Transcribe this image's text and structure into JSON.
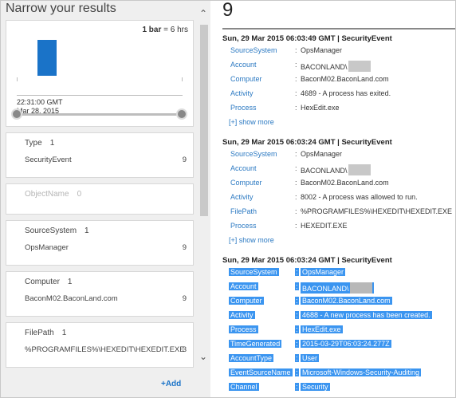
{
  "left_panel": {
    "title": "Narrow your results",
    "histogram": {
      "bar_note_bold": "1 bar",
      "bar_note_rest": " = 6 hrs",
      "label_time": "22:31:00 GMT",
      "label_date": "Mar 28, 2015",
      "accent_color": "#1a73c8"
    },
    "facets": [
      {
        "title": "Type",
        "count": "1",
        "row_label": "SecurityEvent",
        "row_value": "9",
        "dimmed": false
      },
      {
        "title": "ObjectName",
        "count": "0",
        "row_label": "",
        "row_value": "",
        "dimmed": true
      },
      {
        "title": "SourceSystem",
        "count": "1",
        "row_label": "OpsManager",
        "row_value": "9",
        "dimmed": false
      },
      {
        "title": "Computer",
        "count": "1",
        "row_label": "BaconM02.BaconLand.com",
        "row_value": "9",
        "dimmed": false
      },
      {
        "title": "FilePath",
        "count": "1",
        "row_label": "%PROGRAMFILES%\\HEXEDIT\\HEXEDIT.EXE",
        "row_value": "3",
        "dimmed": false
      }
    ],
    "add_link": "+Add"
  },
  "results": {
    "count": "9",
    "events": [
      {
        "header": "Sun, 29 Mar 2015 06:03:49 GMT | SecurityEvent",
        "selected": false,
        "fields": [
          {
            "key": "SourceSystem",
            "value": "OpsManager",
            "redacted": false
          },
          {
            "key": "Account",
            "value": "BACONLAND\\",
            "redacted": true
          },
          {
            "key": "Computer",
            "value": "BaconM02.BaconLand.com",
            "redacted": false
          },
          {
            "key": "Activity",
            "value": "4689 - A process has exited.",
            "redacted": false
          },
          {
            "key": "Process",
            "value": "HexEdit.exe",
            "redacted": false
          }
        ],
        "show_more": "[+] show more"
      },
      {
        "header": "Sun, 29 Mar 2015 06:03:24 GMT | SecurityEvent",
        "selected": false,
        "fields": [
          {
            "key": "SourceSystem",
            "value": "OpsManager",
            "redacted": false
          },
          {
            "key": "Account",
            "value": "BACONLAND\\",
            "redacted": true
          },
          {
            "key": "Computer",
            "value": "BaconM02.BaconLand.com",
            "redacted": false
          },
          {
            "key": "Activity",
            "value": "8002 - A process was allowed to run.",
            "redacted": false
          },
          {
            "key": "FilePath",
            "value": "%PROGRAMFILES%\\HEXEDIT\\HEXEDIT.EXE",
            "redacted": false
          },
          {
            "key": "Process",
            "value": "HEXEDIT.EXE",
            "redacted": false
          }
        ],
        "show_more": "[+] show more"
      },
      {
        "header": "Sun, 29 Mar 2015 06:03:24 GMT | SecurityEvent",
        "selected": true,
        "fields": [
          {
            "key": "SourceSystem",
            "value": "OpsManager",
            "redacted": false
          },
          {
            "key": "Account",
            "value": "BACONLAND\\",
            "redacted": true
          },
          {
            "key": "Computer",
            "value": "BaconM02.BaconLand.com",
            "redacted": false
          },
          {
            "key": "Activity",
            "value": "4688 - A new process has been created.",
            "redacted": false
          },
          {
            "key": "Process",
            "value": "HexEdit.exe",
            "redacted": false
          },
          {
            "key": "TimeGenerated",
            "value": "2015-03-29T06:03:24.277Z",
            "redacted": false
          },
          {
            "key": "AccountType",
            "value": "User",
            "redacted": false
          },
          {
            "key": "EventSourceName",
            "value": "Microsoft-Windows-Security-Auditing",
            "redacted": false
          },
          {
            "key": "Channel",
            "value": "Security",
            "redacted": false
          }
        ],
        "show_more": ""
      }
    ]
  }
}
